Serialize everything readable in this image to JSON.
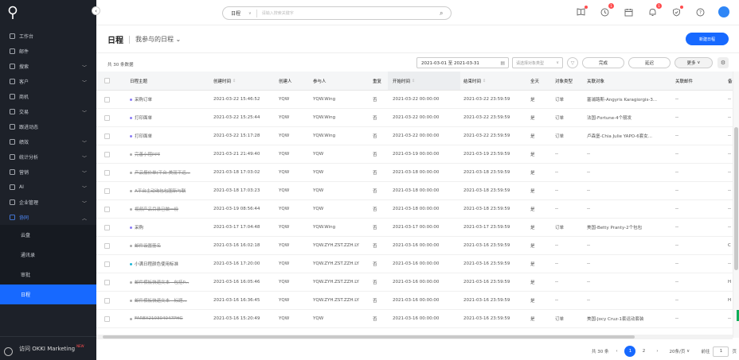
{
  "sidebar": {
    "items": [
      {
        "label": "工作台",
        "icon": "home-icon",
        "arrow": false
      },
      {
        "label": "邮件",
        "icon": "mail-icon",
        "arrow": false
      },
      {
        "label": "搜索",
        "icon": "search-icon",
        "arrow": true
      },
      {
        "label": "客户",
        "icon": "customer-icon",
        "arrow": true
      },
      {
        "label": "商机",
        "icon": "opportunity-icon",
        "arrow": false
      },
      {
        "label": "交易",
        "icon": "trade-icon",
        "arrow": true
      },
      {
        "label": "跟进动态",
        "icon": "followup-icon",
        "arrow": false
      },
      {
        "label": "绩效",
        "icon": "performance-icon",
        "arrow": true
      },
      {
        "label": "统计分析",
        "icon": "analytics-icon",
        "arrow": true
      },
      {
        "label": "营销",
        "icon": "marketing-icon",
        "arrow": true
      },
      {
        "label": "AI",
        "icon": "ai-icon",
        "arrow": true
      },
      {
        "label": "企业管理",
        "icon": "org-icon",
        "arrow": true
      },
      {
        "label": "协同",
        "icon": "collab-icon",
        "arrow": true
      }
    ],
    "sub_items": [
      "云盘",
      "通讯录",
      "审批",
      "日程"
    ],
    "active_sub": "日程",
    "bottom_label": "访问 OKKI Marketing",
    "bottom_badge": "NEW"
  },
  "topbar": {
    "search_type": "日程",
    "search_placeholder": "请输入搜索关键字",
    "badges": {
      "clock": "1",
      "bell": "1"
    }
  },
  "page": {
    "title": "日程",
    "subtitle": "我参与的日程",
    "new_button": "新建日程",
    "count_text": "共 30 条数据",
    "date_range": "2021-03-01 至 2021-03-31",
    "type_placeholder": "请选择对象类型",
    "done_button": "完成",
    "delay_button": "延迟",
    "more_button": "更多"
  },
  "table": {
    "columns": [
      "日程主题",
      "创建时间",
      "创建人",
      "参与人",
      "重复",
      "开始时间",
      "结束时间",
      "全天",
      "对象类型",
      "关联对象",
      "关联邮件",
      "备"
    ],
    "rows": [
      {
        "subject": "采购订单",
        "dot": "#8b7cf6",
        "created": "2021-03-22 15:46:52",
        "creator": "YQW",
        "participants": "YQW.Wing",
        "repeat": "否",
        "start": "2021-03-22 00:00:00",
        "end": "2021-03-22 23:59:59",
        "allday": "是",
        "objtype": "订单",
        "related": "塞浦路斯-Angyris Karagiorgis-3...",
        "mail": "--",
        "note": "--",
        "strike": false
      },
      {
        "subject": "打印面单",
        "dot": "#8b7cf6",
        "created": "2021-03-22 15:25:44",
        "creator": "YQW",
        "participants": "YQW.Wing",
        "repeat": "否",
        "start": "2021-03-22 00:00:00",
        "end": "2021-03-22 23:59:59",
        "allday": "是",
        "objtype": "订单",
        "related": "法国-Fortune-4个靓发",
        "mail": "--",
        "note": "--",
        "strike": false
      },
      {
        "subject": "打印面单",
        "dot": "#8b7cf6",
        "created": "2021-03-22 15:17:28",
        "creator": "YQW",
        "participants": "YQW.Wing",
        "repeat": "否",
        "start": "2021-03-22 00:00:00",
        "end": "2021-03-22 23:59:59",
        "allday": "是",
        "objtype": "订单",
        "related": "卢森堡-Chia Julie YAPO-6套女...",
        "mail": "--",
        "note": "--",
        "strike": false
      },
      {
        "subject": "完善小程PPT",
        "dot": "#aaaaaa",
        "created": "2021-03-21 21:49:40",
        "creator": "YQW",
        "participants": "YQW",
        "repeat": "否",
        "start": "2021-03-19 00:00:00",
        "end": "2021-03-19 23:59:59",
        "allday": "是",
        "objtype": "--",
        "related": "--",
        "mail": "--",
        "note": "--",
        "strike": true
      },
      {
        "subject": "产品报价单(平台-美丽平远...",
        "dot": "#aaaaaa",
        "created": "2021-03-18 17:03:02",
        "creator": "YQW",
        "participants": "YQW",
        "repeat": "否",
        "start": "2021-03-18 00:00:00",
        "end": "2021-03-18 23:59:59",
        "allday": "是",
        "objtype": "--",
        "related": "--",
        "mail": "--",
        "note": "--",
        "strike": true
      },
      {
        "subject": "A平台主动询包包图新与联",
        "dot": "#aaaaaa",
        "created": "2021-03-18 17:03:23",
        "creator": "YQW",
        "participants": "YQW",
        "repeat": "否",
        "start": "2021-03-18 00:00:00",
        "end": "2021-03-18 23:59:59",
        "allday": "是",
        "objtype": "--",
        "related": "--",
        "mail": "--",
        "note": "--",
        "strike": true
      },
      {
        "subject": "视频产品目录已做一份",
        "dot": "#aaaaaa",
        "created": "2021-03-19 08:56:44",
        "creator": "YQW",
        "participants": "YQW",
        "repeat": "否",
        "start": "2021-03-18 00:00:00",
        "end": "2021-03-18 23:59:59",
        "allday": "是",
        "objtype": "--",
        "related": "--",
        "mail": "--",
        "note": "--",
        "strike": true
      },
      {
        "subject": "采购",
        "dot": "#8b7cf6",
        "created": "2021-03-17 17:04:48",
        "creator": "YQW",
        "participants": "YQW.Wing",
        "repeat": "否",
        "start": "2021-03-17 00:00:00",
        "end": "2021-03-17 23:59:59",
        "allday": "是",
        "objtype": "订单",
        "related": "美国-Betty Pranty-2个包包",
        "mail": "--",
        "note": "--",
        "strike": false
      },
      {
        "subject": "邮件设置签名",
        "dot": "#aaaaaa",
        "created": "2021-03-16 16:02:18",
        "creator": "YQW",
        "participants": "YQW.ZYH.ZST.ZZH.LY",
        "repeat": "否",
        "start": "2021-03-16 00:00:00",
        "end": "2021-03-16 23:59:59",
        "allday": "是",
        "objtype": "--",
        "related": "--",
        "mail": "--",
        "note": "C",
        "strike": true
      },
      {
        "subject": "小满日程颜色使用标准",
        "dot": "#1fb6d6",
        "created": "2021-03-16 17:20:00",
        "creator": "YQW",
        "participants": "YQW.ZYH.ZST.ZZH.LY",
        "repeat": "否",
        "start": "2021-03-16 00:00:00",
        "end": "2021-03-16 23:59:59",
        "allday": "是",
        "objtype": "--",
        "related": "--",
        "mail": "--",
        "note": "--",
        "strike": false
      },
      {
        "subject": "邮件模板快速文本 - 包括P...",
        "dot": "#aaaaaa",
        "created": "2021-03-16 16:05:46",
        "creator": "YQW",
        "participants": "YQW.ZYH.ZST.ZZH.LY",
        "repeat": "否",
        "start": "2021-03-16 00:00:00",
        "end": "2021-03-16 23:59:59",
        "allday": "是",
        "objtype": "--",
        "related": "--",
        "mail": "--",
        "note": "H",
        "strike": true
      },
      {
        "subject": "邮件模板快速文本 - 标题...",
        "dot": "#aaaaaa",
        "created": "2021-03-16 16:36:45",
        "creator": "YQW",
        "participants": "YQW.ZYH.ZST.ZZH.LY",
        "repeat": "否",
        "start": "2021-03-16 00:00:00",
        "end": "2021-03-16 23:59:59",
        "allday": "是",
        "objtype": "--",
        "related": "--",
        "mail": "--",
        "note": "H",
        "strike": true
      },
      {
        "subject": "FAREX210304047PHG",
        "dot": "#aaaaaa",
        "created": "2021-03-16 15:20:49",
        "creator": "YQW",
        "participants": "YQW",
        "repeat": "否",
        "start": "2021-03-16 00:00:00",
        "end": "2021-03-16 23:59:59",
        "allday": "是",
        "objtype": "订单",
        "related": "美国-Jocy Cruz-1套运动套装",
        "mail": "--",
        "note": "--",
        "strike": true
      }
    ]
  },
  "pager": {
    "total": "共 30 条",
    "pages": [
      "1",
      "2"
    ],
    "current": "1",
    "size": "20条/页",
    "goto_label": "前往",
    "goto_value": "1",
    "page_suffix": "页"
  }
}
